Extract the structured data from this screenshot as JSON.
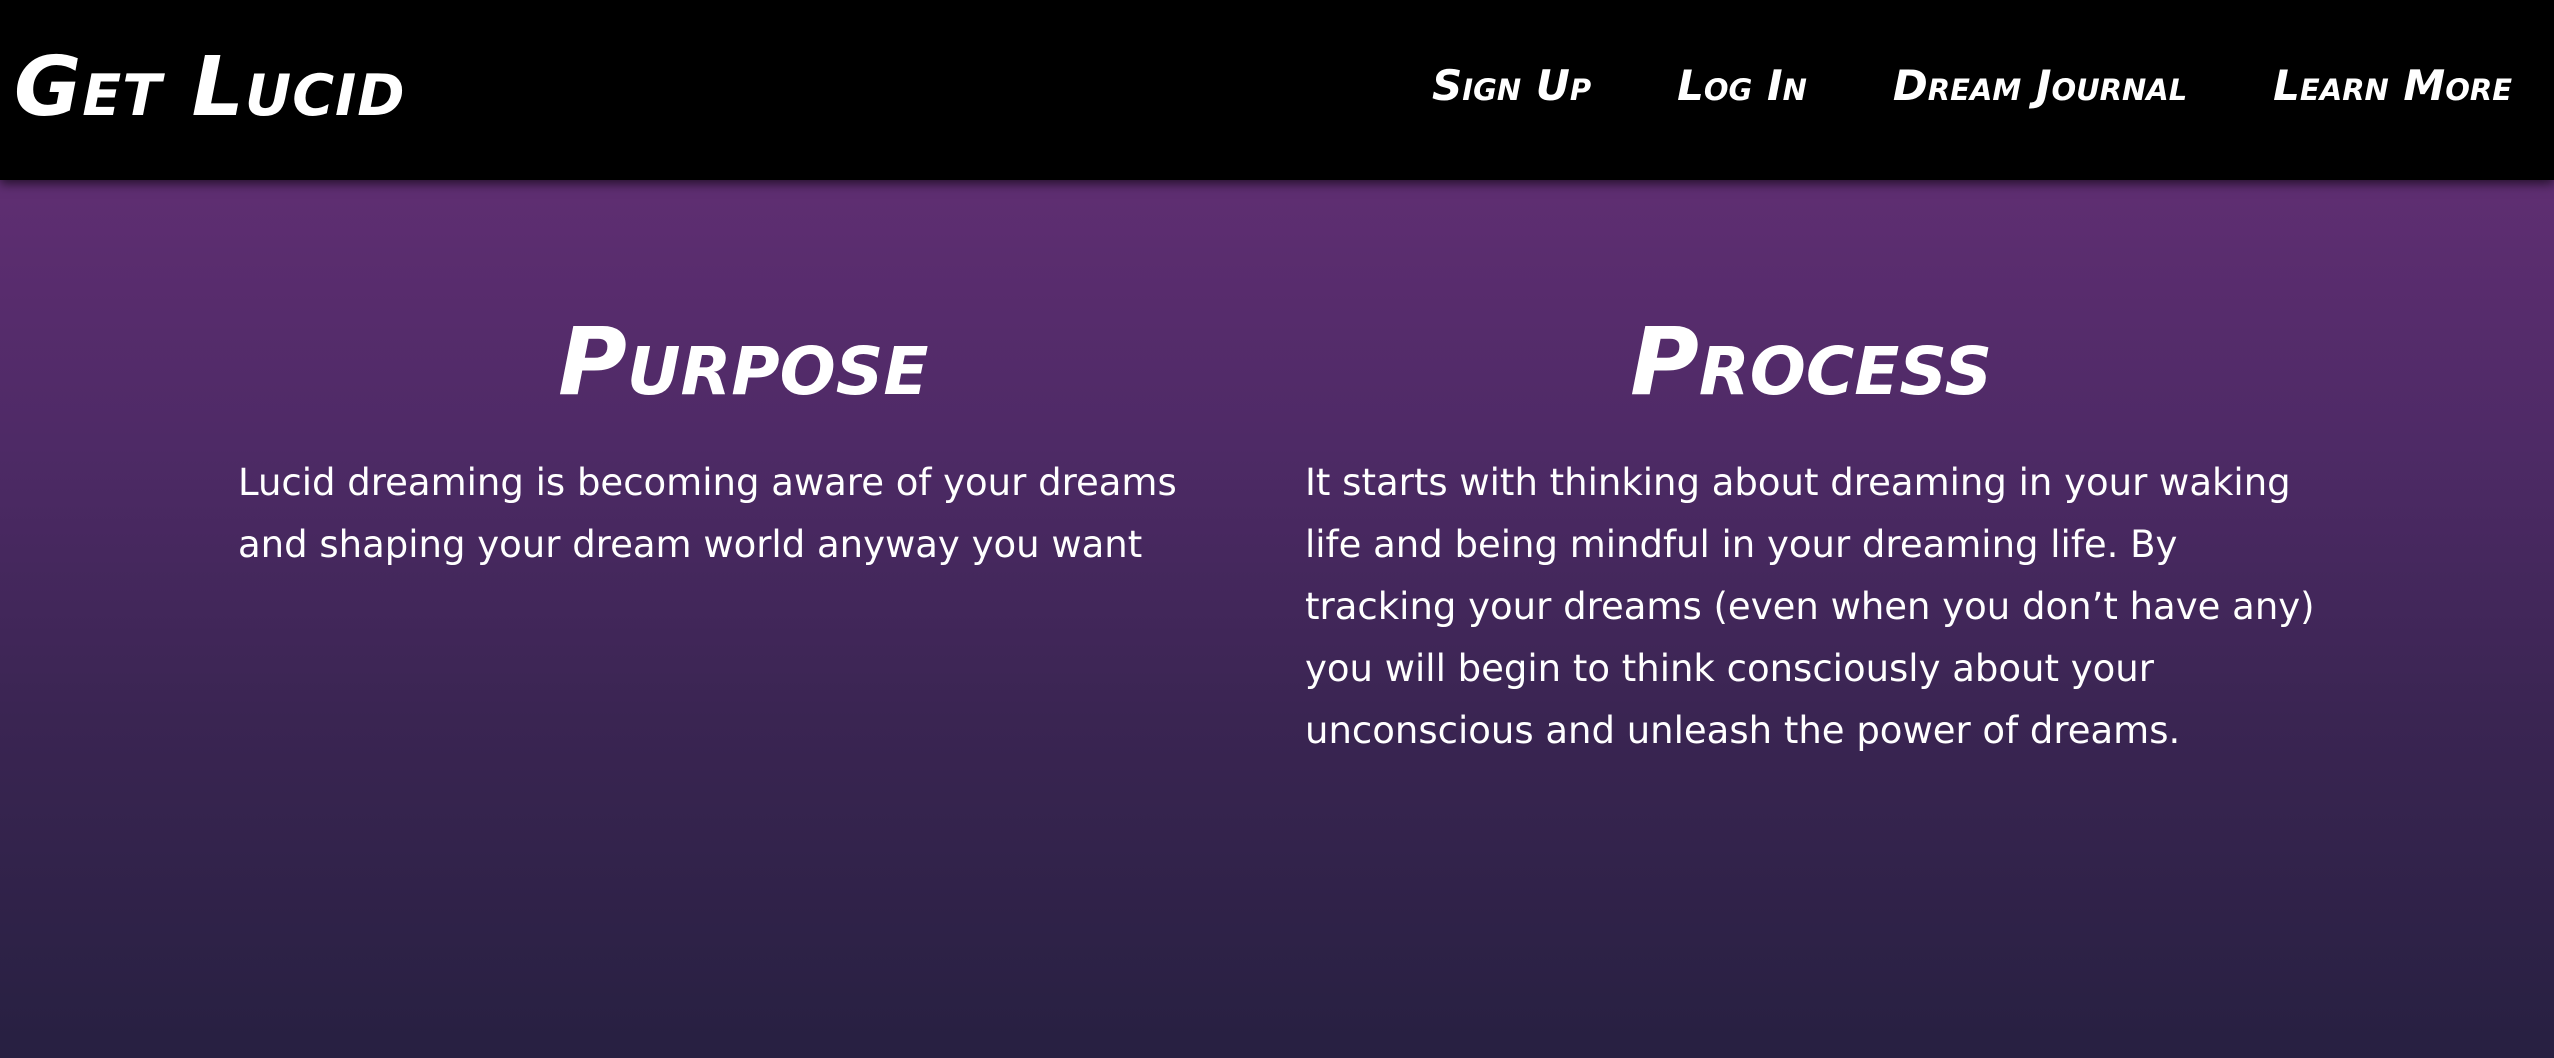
{
  "navbar": {
    "brand": "Get Lucid",
    "links": [
      {
        "label": "Sign Up"
      },
      {
        "label": "Log In"
      },
      {
        "label": "Dream Journal"
      },
      {
        "label": "Learn More"
      }
    ]
  },
  "main": {
    "sections": [
      {
        "heading": "Purpose",
        "text": "Lucid dreaming is becoming aware of your dreams and shaping your dream world anyway you want"
      },
      {
        "heading": "Process",
        "text": "It starts with thinking about dreaming in your waking life and being mindful in your dreaming life. By tracking your dreams (even when you don’t have any) you will begin to think consciously about your unconscious and unleash the power of dreams."
      }
    ]
  },
  "colors": {
    "navbar_bg": "#000000",
    "gradient_top": "#5f2e72",
    "gradient_bottom": "#272041",
    "text": "#ffffff"
  }
}
